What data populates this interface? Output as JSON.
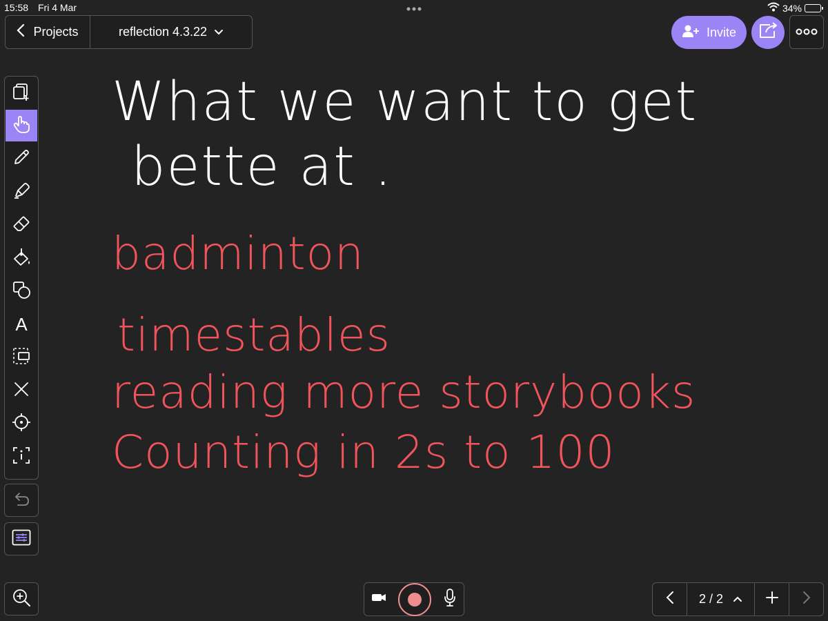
{
  "status_bar": {
    "time": "15:58",
    "date": "Fri 4 Mar",
    "battery": "34%",
    "battery_level": 0.34
  },
  "header": {
    "back_label": "Projects",
    "project_title": "reflection 4.3.22",
    "invite_label": "Invite"
  },
  "toolbar": {
    "tools": [
      "add-page",
      "hand",
      "pen",
      "highlighter",
      "eraser",
      "fill",
      "shapes",
      "text",
      "select",
      "clear",
      "laser",
      "info"
    ],
    "active_tool": "hand",
    "text_tool_label": "A"
  },
  "canvas": {
    "heading_line1": "What we want to get",
    "heading_line2": "bette at .",
    "list_items": [
      "badminton",
      "timestables",
      "reading more storybooks",
      "Counting in 2s to 100"
    ],
    "heading_color": "#ffffff",
    "list_color": "#f2545b"
  },
  "pagination": {
    "page_indicator": "2 / 2"
  },
  "colors": {
    "accent": "#9b84f6",
    "record": "#f08d8d",
    "background": "#232323"
  }
}
